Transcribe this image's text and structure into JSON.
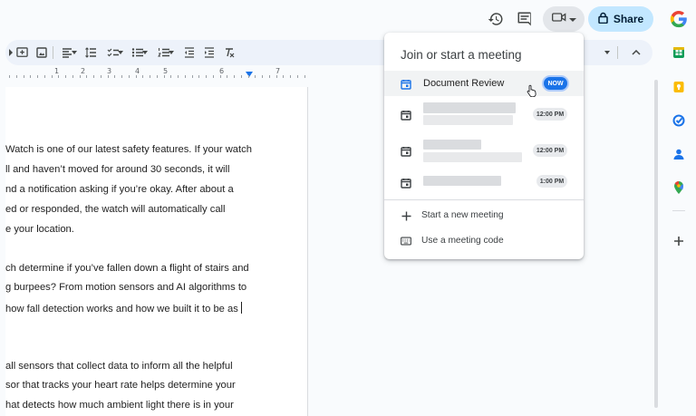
{
  "header": {
    "share_label": "Share",
    "icons": [
      "history-icon",
      "comment-icon",
      "video-call-icon",
      "lock-icon",
      "google-icon"
    ]
  },
  "toolbar": {
    "icons": [
      "insert-comment-icon",
      "insert-image-icon",
      "align-icon",
      "line-spacing-icon",
      "checklist-icon",
      "bulleted-list-icon",
      "numbered-list-icon",
      "decrease-indent-icon",
      "increase-indent-icon",
      "clear-formatting-icon"
    ]
  },
  "ruler": {
    "numbers": [
      "1",
      "2",
      "3",
      "4",
      "5",
      "6",
      "7"
    ]
  },
  "document": {
    "lines": [
      "Watch is one of our latest safety features. If your watch",
      "ll and haven’t moved for around 30 seconds, it will",
      "nd a notification asking if you’re okay. After about a",
      "ed or responded, the watch will automatically call",
      "e your location.",
      "",
      "ch determine if you’ve fallen down a flight of stairs and",
      "g burpees? From motion sensors and AI algorithms to",
      "how fall detection works and how we built it to be as",
      "",
      "",
      "all sensors that collect data to inform all the helpful",
      "sor that tracks your heart rate helps determine your",
      "hat detects how much ambient light there is in your"
    ]
  },
  "meet_menu": {
    "title": "Join or start a meeting",
    "meetings": [
      {
        "title": "Document Review",
        "badge": "NOW"
      },
      {
        "title": "",
        "badge": "12:00 PM"
      },
      {
        "title": "",
        "badge": "12:00 PM"
      },
      {
        "title": "",
        "badge": "1:00 PM"
      }
    ],
    "actions": [
      {
        "label": "Start a new meeting",
        "icon": "plus-icon"
      },
      {
        "label": "Use a meeting code",
        "icon": "keyboard-icon"
      }
    ]
  },
  "side_rail": {
    "icons": [
      "sheets-icon",
      "keep-icon",
      "tasks-icon",
      "contacts-icon",
      "maps-icon",
      "add-icon"
    ]
  },
  "colors": {
    "accent": "#1a73e8",
    "share_bg": "#c2e7ff",
    "toolbar_bg": "#edf2fa"
  }
}
